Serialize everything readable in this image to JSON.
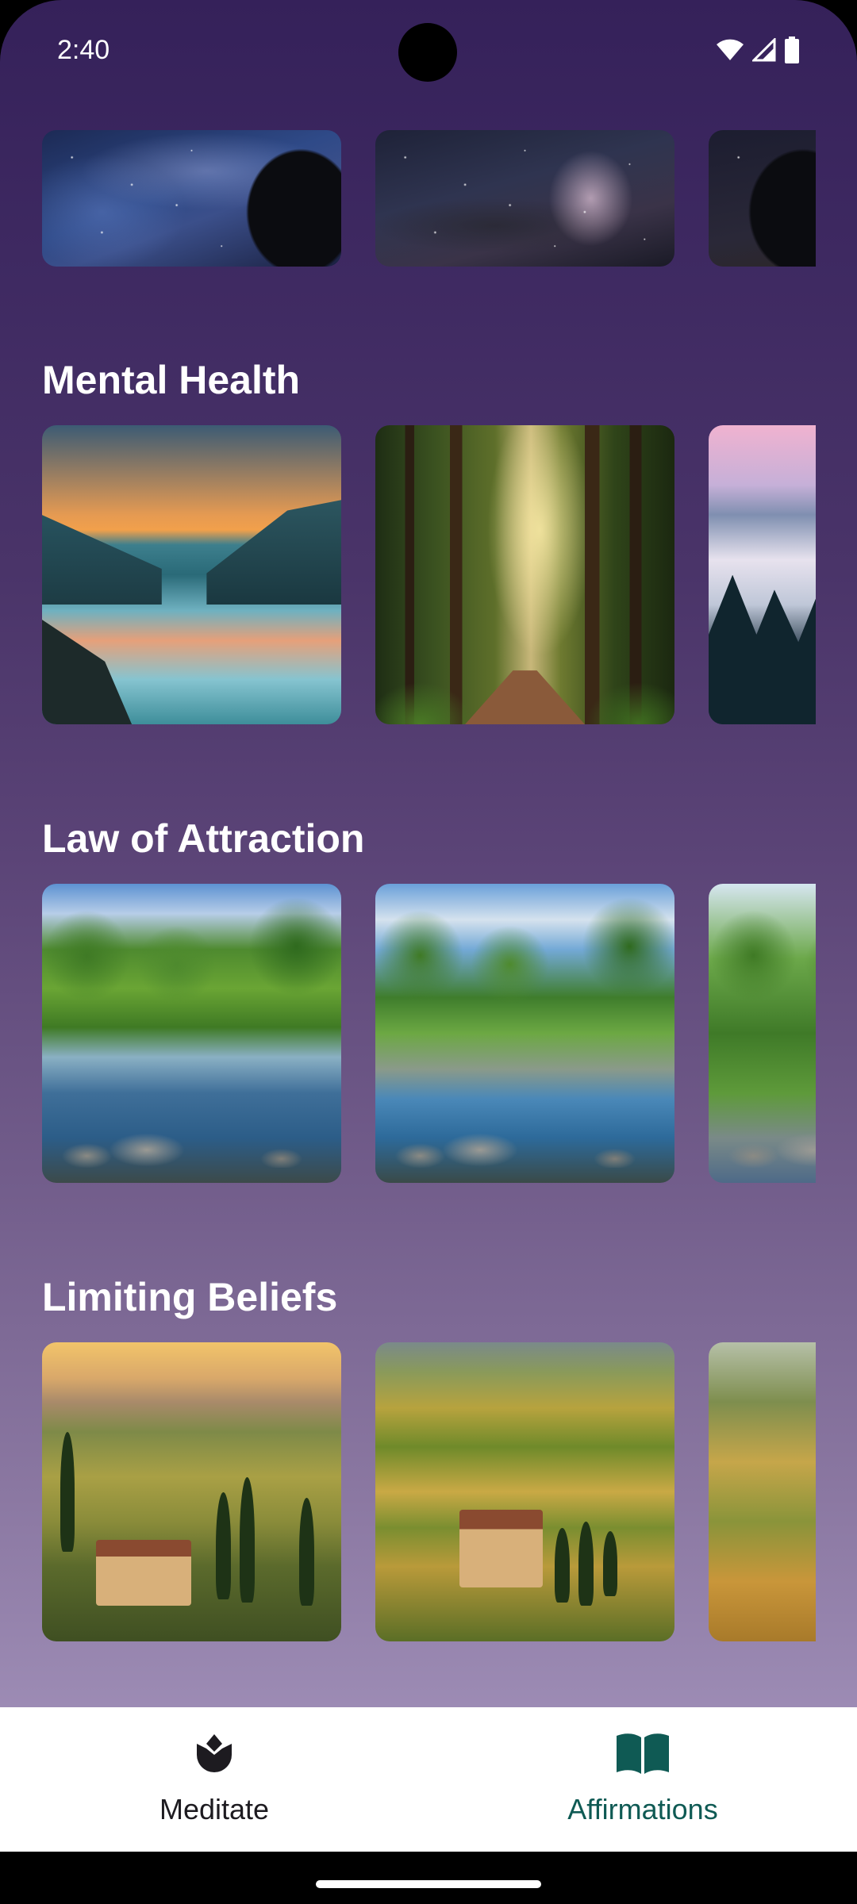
{
  "status_bar": {
    "time": "2:40",
    "icons": [
      "wifi-icon",
      "signal-icon",
      "battery-icon"
    ]
  },
  "sections": [
    {
      "title": "",
      "cards": [
        "night-sky-1",
        "night-sky-2",
        "night-sky-3"
      ]
    },
    {
      "title": "Mental Health",
      "cards": [
        "lake-sunset",
        "forest-path",
        "misty-pines"
      ]
    },
    {
      "title": "Law of Attraction",
      "cards": [
        "garden-stream-1",
        "garden-stream-2",
        "garden-stream-3"
      ]
    },
    {
      "title": "Limiting Beliefs",
      "cards": [
        "tuscany-villa-1",
        "tuscany-villa-2",
        "tuscany-hills-3"
      ]
    }
  ],
  "bottom_nav": {
    "items": [
      {
        "label": "Meditate",
        "icon": "lotus-icon",
        "selected": false,
        "color": "#1d1b20"
      },
      {
        "label": "Affirmations",
        "icon": "open-book-icon",
        "selected": true,
        "color": "#0f5a54"
      }
    ]
  },
  "colors": {
    "background_top": "#35215a",
    "background_bottom": "#a08fb8",
    "nav_background": "#ffffff",
    "active_accent": "#0f5a54"
  }
}
